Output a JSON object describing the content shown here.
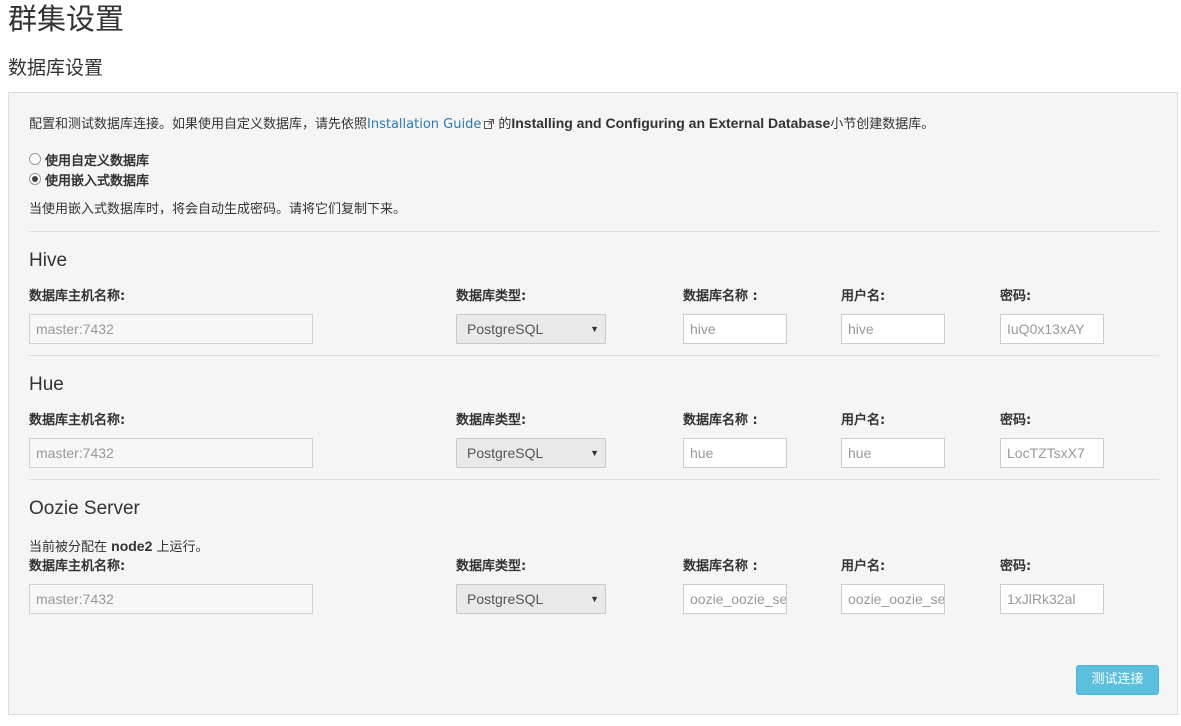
{
  "page": {
    "title": "群集设置",
    "section_title": "数据库设置"
  },
  "intro": {
    "prefix": "配置和测试数据库连接。如果使用自定义数据库，请先依照",
    "link": "Installation Guide",
    "middle": "的",
    "bold": "Installing and Configuring an External Database",
    "suffix": "小节创建数据库。"
  },
  "options": {
    "custom_db": "使用自定义数据库",
    "embedded_db": "使用嵌入式数据库",
    "selected": "embedded"
  },
  "note": "当使用嵌入式数据库时，将会自动生成密码。请将它们复制下来。",
  "labels": {
    "host": "数据库主机名称:",
    "type": "数据库类型:",
    "db_name": "数据库名称 :",
    "user": "用户名:",
    "password": "密码:"
  },
  "services": {
    "hive": {
      "title": "Hive",
      "host": "master:7432",
      "type": "PostgreSQL",
      "db_name": "hive",
      "user": "hive",
      "password": "IuQ0x13xAY"
    },
    "hue": {
      "title": "Hue",
      "host": "master:7432",
      "type": "PostgreSQL",
      "db_name": "hue",
      "user": "hue",
      "password": "LocTZTsxX7"
    },
    "oozie": {
      "title": "Oozie Server",
      "assign_prefix": "当前被分配在",
      "assign_node": "node2",
      "assign_suffix": "上运行。",
      "host": "master:7432",
      "type": "PostgreSQL",
      "db_name": "oozie_oozie_se",
      "user": "oozie_oozie_se",
      "password": "1xJlRk32al"
    }
  },
  "buttons": {
    "test_connection": "测试连接"
  },
  "colors": {
    "link": "#2a7ab0",
    "button": "#5bc0de"
  }
}
